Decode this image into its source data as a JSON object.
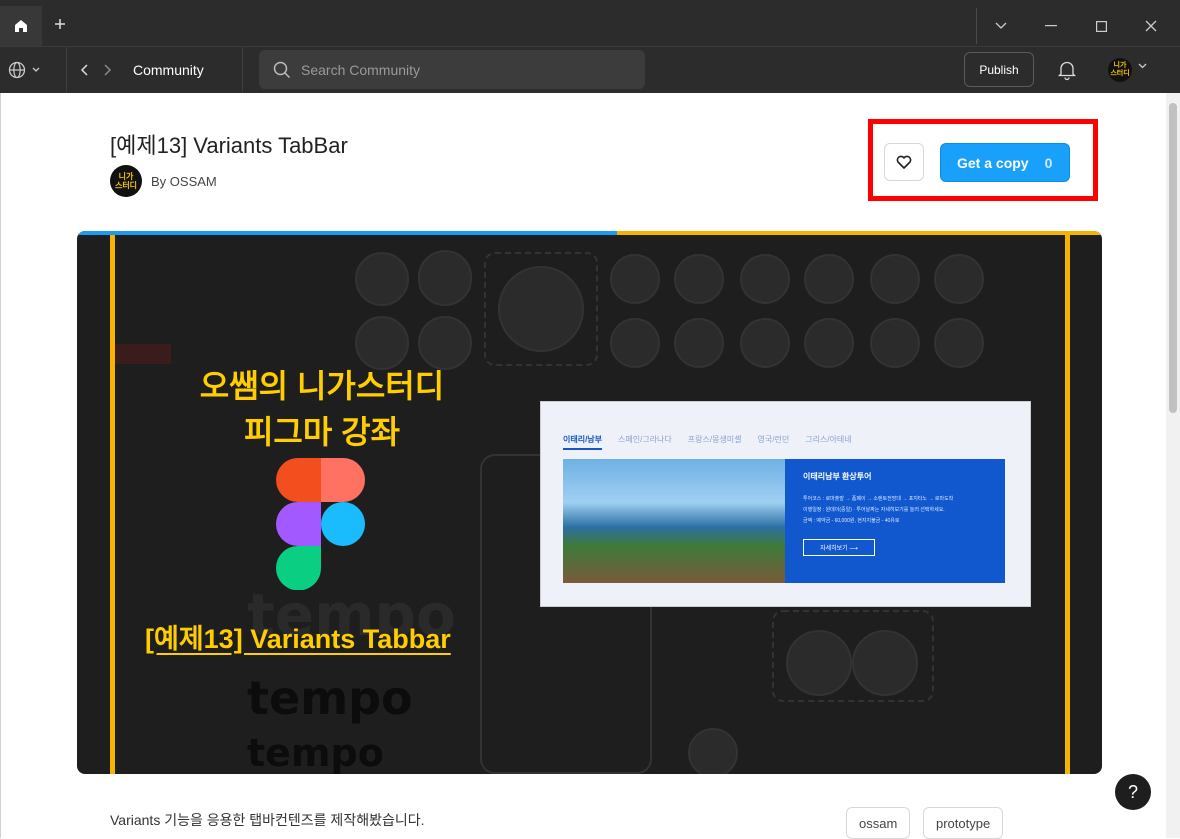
{
  "window": {
    "home_icon": "home-icon",
    "new_tab_icon": "plus-icon",
    "controls": [
      "chevron-down-icon",
      "minimize-icon",
      "maximize-icon",
      "close-icon"
    ]
  },
  "toolbar": {
    "breadcrumb": "Community",
    "search_placeholder": "Search Community",
    "publish_label": "Publish",
    "avatar_text": "니가\n스터디"
  },
  "file": {
    "title": "[예제13] Variants TabBar",
    "author": "By OSSAM",
    "author_avatar_text": "니가\n스터디",
    "copy_label": "Get a copy",
    "copy_count": "0",
    "description": "Variants 기능을 응용한 탭바컨텐즈를 제작해봤습니다.",
    "tags": [
      "ossam",
      "prototype"
    ]
  },
  "hero": {
    "title_line1": "오쌤의 니가스터디",
    "title_line2": "피그마 강좌",
    "subtitle": "[예제13] Variants Tabbar",
    "tempo_text": "tempo",
    "mock_tabs": [
      "이태리/남부",
      "스페인/그라나다",
      "프랑스/몽생미셸",
      "영국/런던",
      "그리스/아테네"
    ],
    "mock_panel_title": "이태리남부 환상투어",
    "mock_panel_desc1": "투어코스 : 로마출발 → 폼페이 → 소렌토전망대 → 포지타노 → 로마도착",
    "mock_panel_desc2": "이행일정 : 원데이(중일) · 투어날짜는 자세히보기를 눌러 선택하세요.",
    "mock_panel_desc3": "금액 : 예약금 - 60,000원, 현지지불금 - 40유로",
    "mock_panel_button": "자세히보기 ⟶",
    "colors": {
      "blue": "#1a9bf3",
      "yellow": "#f5b400"
    }
  },
  "help_label": "?"
}
